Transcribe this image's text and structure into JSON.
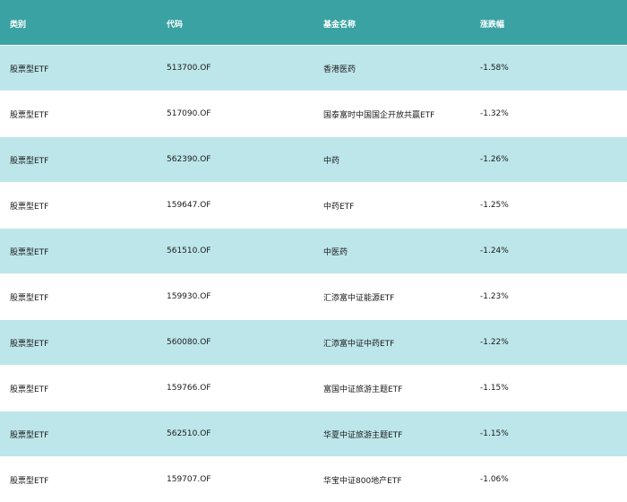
{
  "columns": [
    "类别",
    "代码",
    "基金名称",
    "涨跌幅"
  ],
  "rows": [
    {
      "category": "股票型ETF",
      "code": "513700.OF",
      "name": "香港医药",
      "change": "-1.58%"
    },
    {
      "category": "股票型ETF",
      "code": "517090.OF",
      "name": "国泰富时中国国企开放共赢ETF",
      "change": "-1.32%"
    },
    {
      "category": "股票型ETF",
      "code": "562390.OF",
      "name": "中药",
      "change": "-1.26%"
    },
    {
      "category": "股票型ETF",
      "code": "159647.OF",
      "name": "中药ETF",
      "change": "-1.25%"
    },
    {
      "category": "股票型ETF",
      "code": "561510.OF",
      "name": "中医药",
      "change": "-1.24%"
    },
    {
      "category": "股票型ETF",
      "code": "159930.OF",
      "name": "汇添富中证能源ETF",
      "change": "-1.23%"
    },
    {
      "category": "股票型ETF",
      "code": "560080.OF",
      "name": "汇添富中证中药ETF",
      "change": "-1.22%"
    },
    {
      "category": "股票型ETF",
      "code": "159766.OF",
      "name": "富国中证旅游主题ETF",
      "change": "-1.15%"
    },
    {
      "category": "股票型ETF",
      "code": "562510.OF",
      "name": "华夏中证旅游主题ETF",
      "change": "-1.15%"
    },
    {
      "category": "股票型ETF",
      "code": "159707.OF",
      "name": "华宝中证800地产ETF",
      "change": "-1.06%"
    }
  ],
  "colors": {
    "header_bg": "#3aa2a3",
    "row_alt_bg": "#bde6ea",
    "row_plain_bg": "#ffffff"
  }
}
